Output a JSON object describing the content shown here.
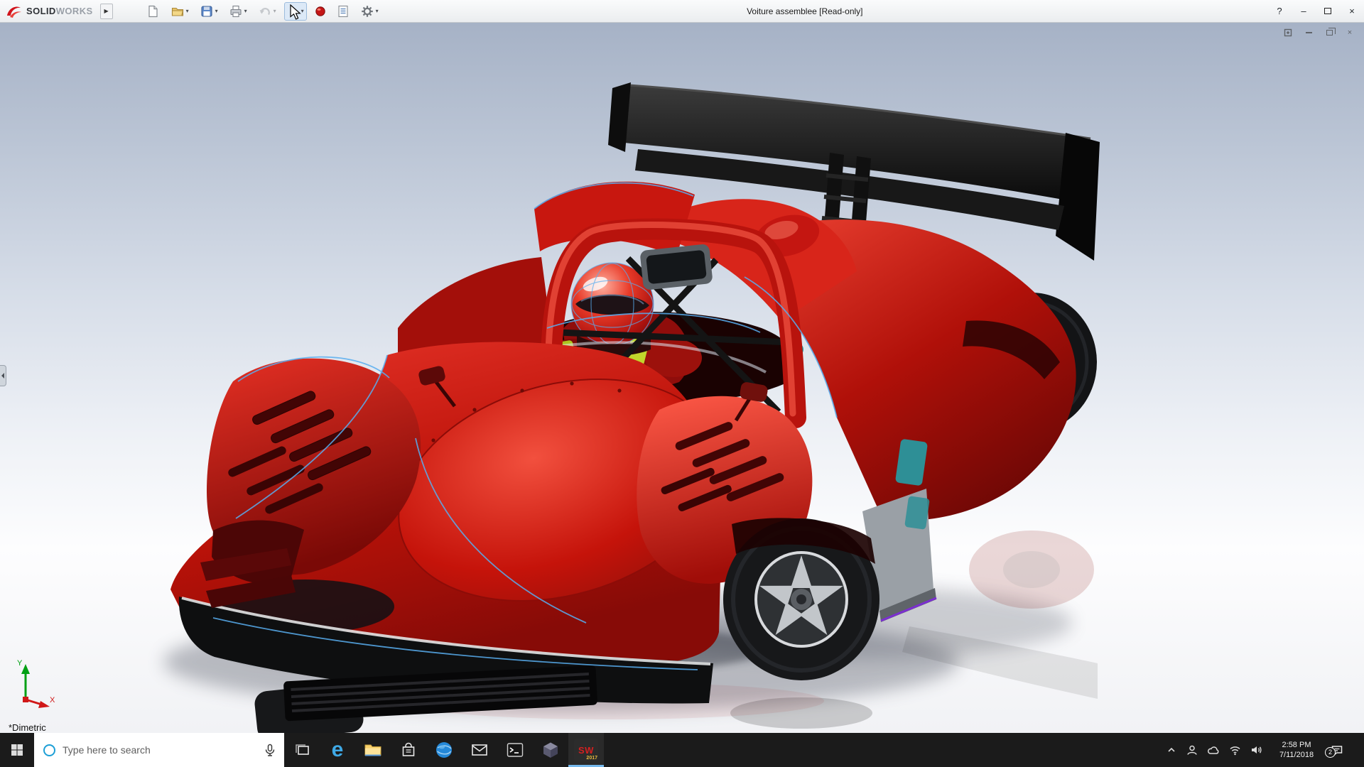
{
  "colors": {
    "solidworks_red": "#d1141c",
    "car_body_red": "#c41510",
    "edge_highlight_blue": "#58aef0",
    "taskbar_bg": "#1b1b1b",
    "viewport_top": "#a6b2c6"
  },
  "titlebar": {
    "brand_solid": "SOLID",
    "brand_works": "WORKS",
    "title": "Voiture assemblee [Read-only]",
    "help_glyph": "?",
    "minimize_glyph": "–",
    "close_glyph": "×"
  },
  "toolbar": {
    "flyout_glyph": "▶",
    "caret_glyph": "▾"
  },
  "viewport": {
    "orientation_label": "*Dimetric",
    "triad": {
      "x_label": "X",
      "y_label": "Y"
    }
  },
  "taskbar": {
    "search_placeholder": "Type here to search",
    "edge_letter": "e",
    "solidworks_label": "SW",
    "solidworks_year": "2017",
    "clock_time": "2:58 PM",
    "clock_date": "7/11/2018",
    "action_center_badge": "2"
  }
}
